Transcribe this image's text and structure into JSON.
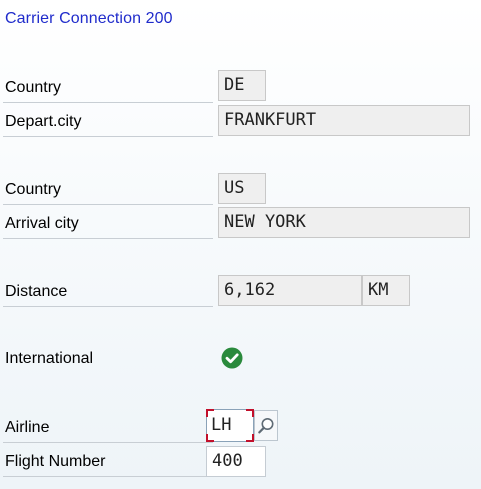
{
  "screen": {
    "title": "Carrier Connection 200"
  },
  "departure": {
    "country_label": "Country",
    "country_value": "DE",
    "city_label": "Depart.city",
    "city_value": "FRANKFURT"
  },
  "arrival": {
    "country_label": "Country",
    "country_value": "US",
    "city_label": "Arrival city",
    "city_value": "NEW YORK"
  },
  "distance": {
    "label": "Distance",
    "value": "6,162",
    "unit": "KM"
  },
  "international": {
    "label": "International",
    "checked": true,
    "icon": "check-circle-icon",
    "icon_color": "#2a8a3c"
  },
  "airline": {
    "label": "Airline",
    "value": "LH",
    "help_icon": "search-help-icon"
  },
  "flight": {
    "label": "Flight Number",
    "value": "400"
  },
  "colors": {
    "title": "#1f2bcb",
    "focus_corners": "#c2102b"
  }
}
